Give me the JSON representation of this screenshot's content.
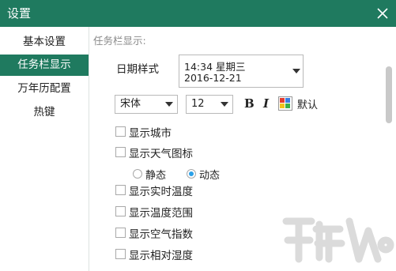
{
  "window": {
    "title": "设置"
  },
  "sidebar": {
    "items": [
      {
        "label": "基本设置",
        "active": false
      },
      {
        "label": "任务栏显示",
        "active": true
      },
      {
        "label": "万年历配置",
        "active": false
      },
      {
        "label": "热键",
        "active": false
      }
    ]
  },
  "taskbar": {
    "section_label": "任务栏显示:",
    "date_style": {
      "label": "日期样式",
      "selected_line1": "14:34 星期三",
      "selected_line2": "2016-12-21"
    },
    "font": {
      "family": "宋体",
      "size": "12",
      "bold": "B",
      "italic": "I",
      "default_label": "默认"
    },
    "options": [
      {
        "label": "显示城市",
        "checked": false
      },
      {
        "label": "显示天气图标",
        "checked": false
      },
      {
        "label": "显示实时温度",
        "checked": false
      },
      {
        "label": "显示温度范围",
        "checked": false
      },
      {
        "label": "显示空气指数",
        "checked": false
      },
      {
        "label": "显示相对湿度",
        "checked": false
      }
    ],
    "weather_icon_mode": [
      {
        "label": "静态",
        "selected": false
      },
      {
        "label": "动态",
        "selected": true
      }
    ]
  },
  "icons": [
    "close-icon",
    "dropdown-arrow-icon",
    "color-palette-icon",
    "watermark-logo"
  ],
  "colors": {
    "accent": "#1f7a5f",
    "radio_selected": "#2aa0e8"
  }
}
